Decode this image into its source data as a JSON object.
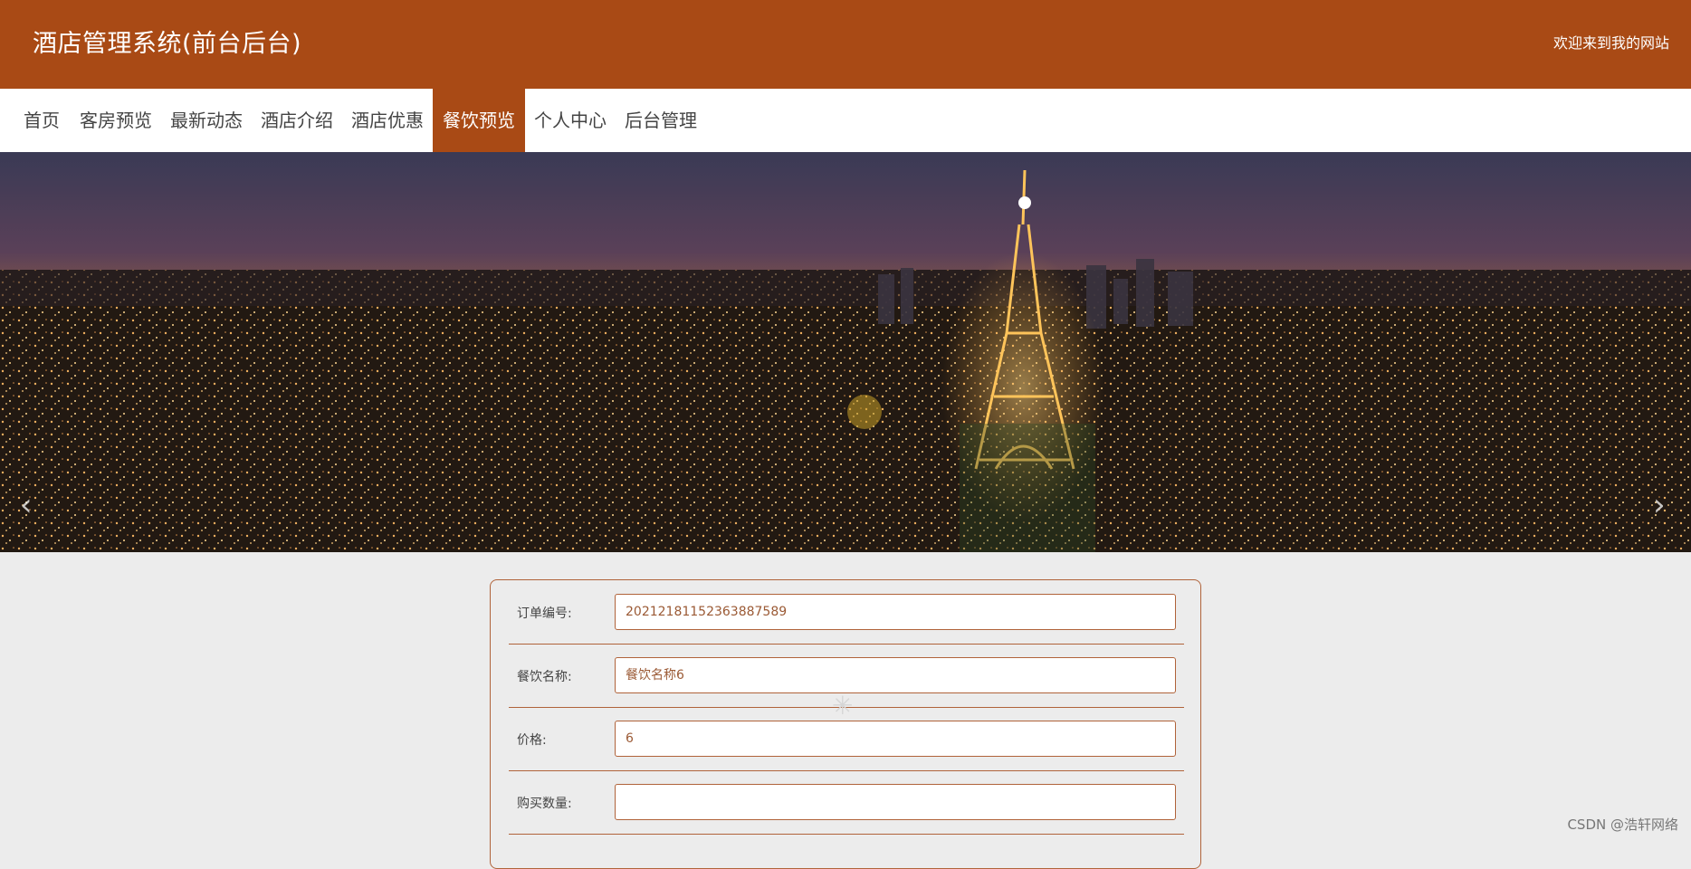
{
  "header": {
    "title": "酒店管理系统(前台后台)",
    "welcome": "欢迎来到我的网站"
  },
  "nav": {
    "items": [
      {
        "label": "首页"
      },
      {
        "label": "客房预览"
      },
      {
        "label": "最新动态"
      },
      {
        "label": "酒店介绍"
      },
      {
        "label": "酒店优惠"
      },
      {
        "label": "餐饮预览",
        "active": true
      },
      {
        "label": "个人中心"
      },
      {
        "label": "后台管理"
      }
    ],
    "active_color": "#a94a15"
  },
  "banner": {
    "prev_icon": "chevron-left-icon",
    "next_icon": "chevron-right-icon",
    "slide_count": 3,
    "active_slide": 1
  },
  "form": {
    "order_no": {
      "label": "订单编号:",
      "value": "20212181152363887589"
    },
    "dish_name": {
      "label": "餐饮名称:",
      "value": "餐饮名称6"
    },
    "price": {
      "label": "价格:",
      "value": "6"
    },
    "quantity": {
      "label": "购买数量:",
      "value": ""
    }
  },
  "watermark": "CSDN @浩轩网络",
  "colors": {
    "brand": "#a94a15",
    "border": "#b0633a",
    "page_bg": "#ececec"
  }
}
